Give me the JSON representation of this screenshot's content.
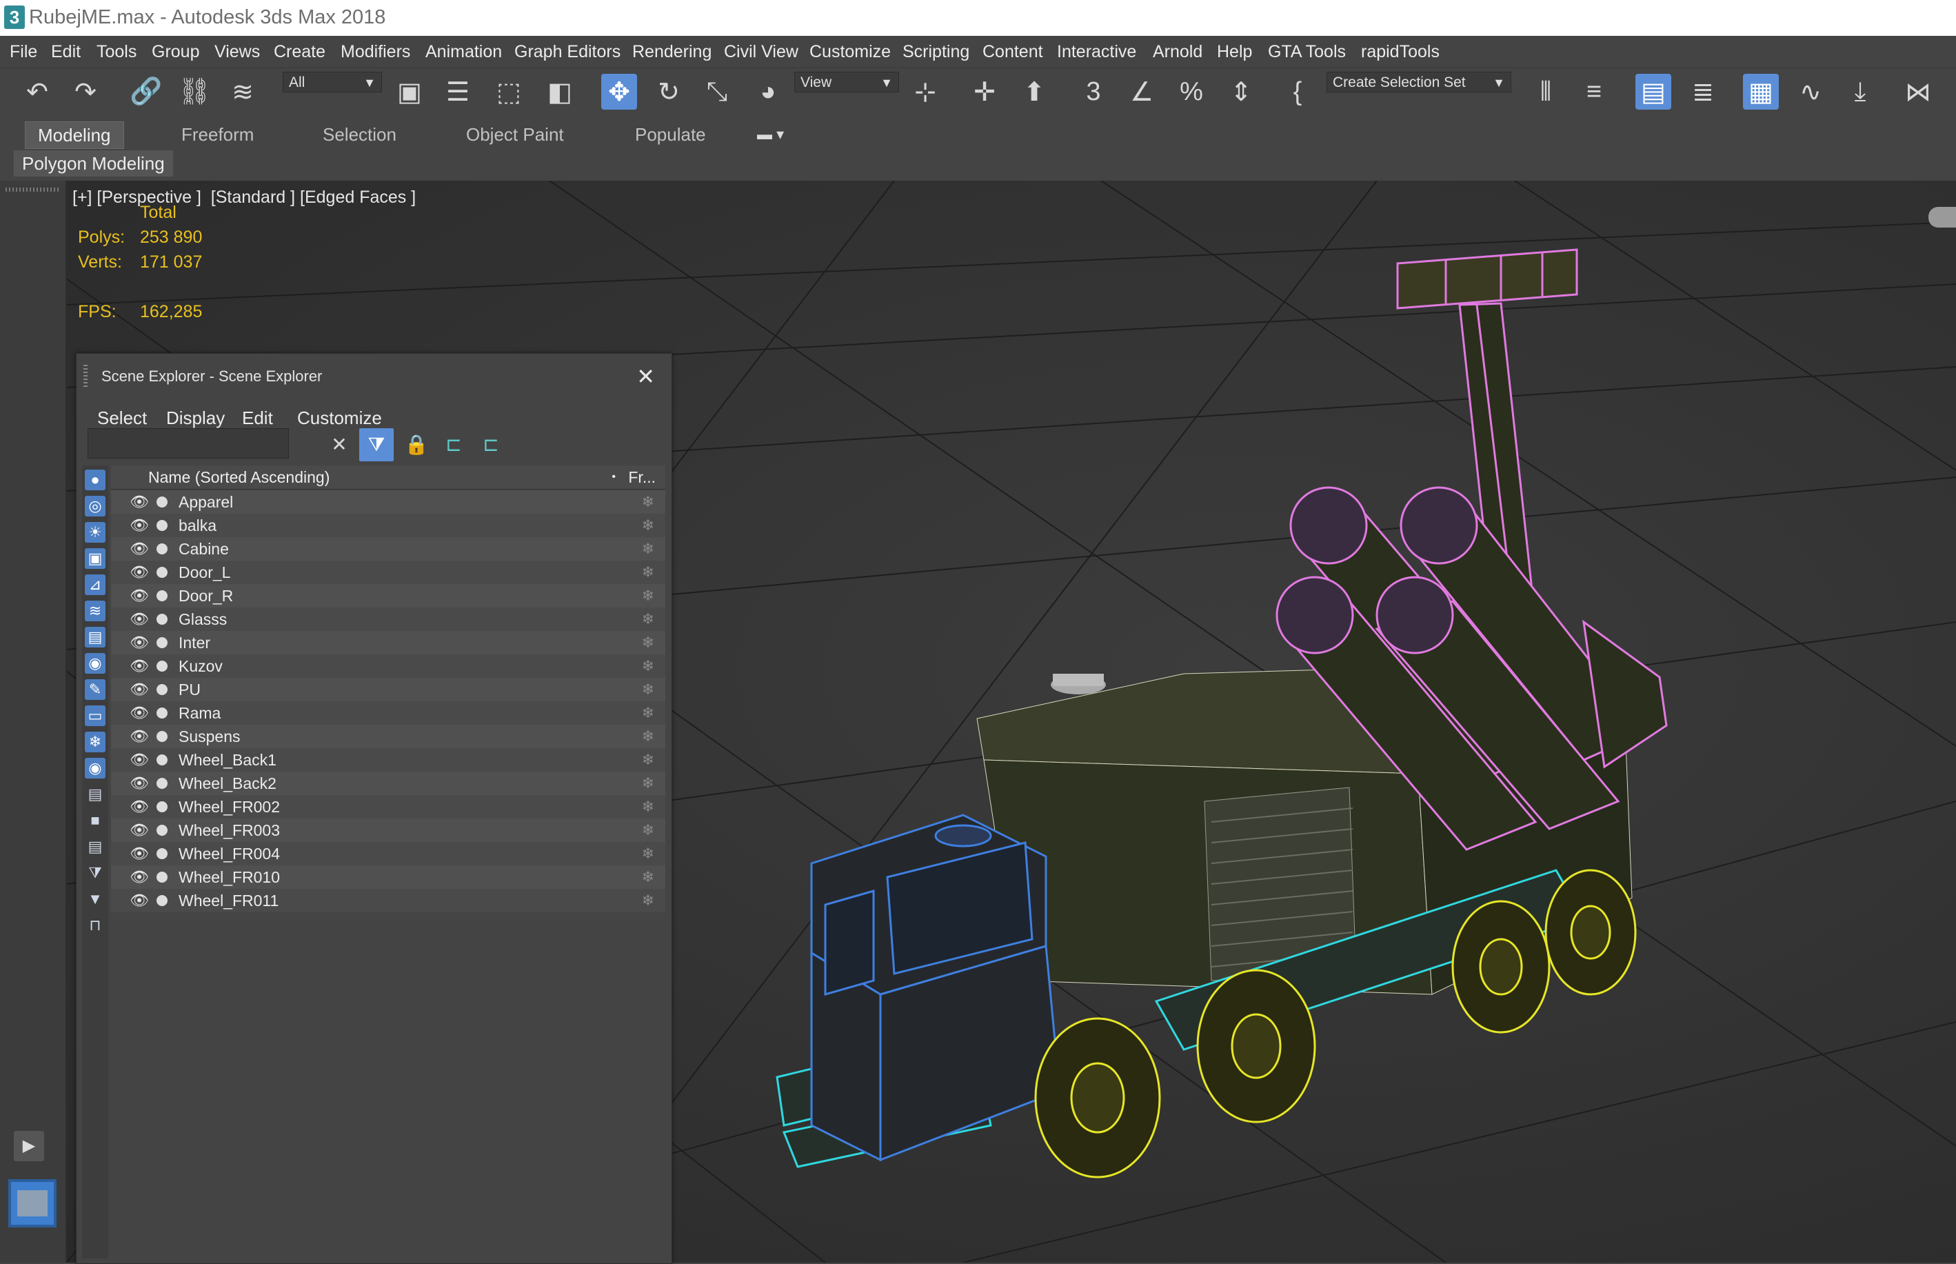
{
  "window": {
    "title": "RubejME.max - Autodesk 3ds Max 2018",
    "app_icon": "3"
  },
  "menu": [
    "File",
    "Edit",
    "Tools",
    "Group",
    "Views",
    "Create",
    "Modifiers",
    "Animation",
    "Graph Editors",
    "Rendering",
    "Civil View",
    "Customize",
    "Scripting",
    "Content",
    "Interactive",
    "Arnold",
    "Help",
    "GTA Tools",
    "rapidTools"
  ],
  "toolbar": {
    "selection_filter": "All",
    "ref_coord": "View",
    "named_selection": "Create Selection Set",
    "active_tool": "select-and-move"
  },
  "ribbon": {
    "tabs": [
      "Modeling",
      "Freeform",
      "Selection",
      "Object Paint",
      "Populate"
    ],
    "active_tab": "Modeling",
    "panel_label": "Polygon Modeling"
  },
  "viewport": {
    "label": "[+] [Perspective ]  [Standard ] [Edged Faces ]",
    "stats": {
      "total_label": "Total",
      "polys_label": "Polys:",
      "polys": "253 890",
      "verts_label": "Verts:",
      "verts": "171 037",
      "fps_label": "FPS:",
      "fps": "162,285"
    }
  },
  "scene_explorer": {
    "title": "Scene Explorer - Scene Explorer",
    "menu": [
      "Select",
      "Display",
      "Edit",
      "Customize"
    ],
    "search_value": "",
    "column_name": "Name (Sorted Ascending)",
    "column_frozen": "Fr...",
    "objects": [
      "Apparel",
      "balka",
      "Cabine",
      "Door_L",
      "Door_R",
      "Glasss",
      "Inter",
      "Kuzov",
      "PU",
      "Rama",
      "Suspens",
      "Wheel_Back1",
      "Wheel_Back2",
      "Wheel_FR002",
      "Wheel_FR003",
      "Wheel_FR004",
      "Wheel_FR010",
      "Wheel_FR011"
    ]
  },
  "colors": {
    "ui_bg": "#444444",
    "accent": "#5b8ed6",
    "stats_text": "#e8c020",
    "wire_cabin": "#3f7fe0",
    "wire_chassis": "#2fd8e0",
    "wire_wheels": "#e6e628",
    "wire_launcher": "#e07ae0",
    "body_fill": "#2e3220"
  }
}
